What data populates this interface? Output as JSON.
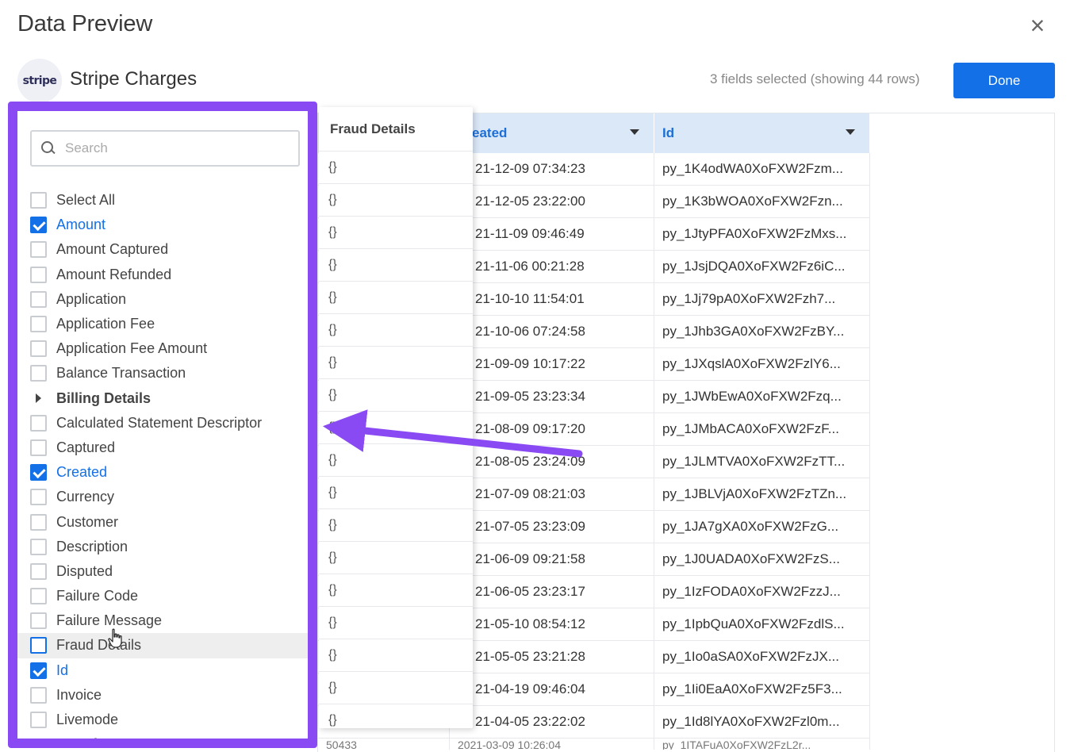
{
  "dialog": {
    "title": "Data Preview",
    "close_glyph": "×"
  },
  "source": {
    "logo_text": "stripe",
    "name": "Stripe Charges",
    "status": "3 fields selected (showing 44 rows)",
    "done_label": "Done"
  },
  "search": {
    "placeholder": "Search",
    "value": ""
  },
  "fields": [
    {
      "label": "Select All",
      "checked": false
    },
    {
      "label": "Amount",
      "checked": true
    },
    {
      "label": "Amount Captured",
      "checked": false
    },
    {
      "label": "Amount Refunded",
      "checked": false
    },
    {
      "label": "Application",
      "checked": false
    },
    {
      "label": "Application Fee",
      "checked": false
    },
    {
      "label": "Application Fee Amount",
      "checked": false
    },
    {
      "label": "Balance Transaction",
      "checked": false
    },
    {
      "label": "Billing Details",
      "group": true
    },
    {
      "label": "Calculated Statement Descriptor",
      "checked": false
    },
    {
      "label": "Captured",
      "checked": false
    },
    {
      "label": "Created",
      "checked": true
    },
    {
      "label": "Currency",
      "checked": false
    },
    {
      "label": "Customer",
      "checked": false
    },
    {
      "label": "Description",
      "checked": false
    },
    {
      "label": "Disputed",
      "checked": false
    },
    {
      "label": "Failure Code",
      "checked": false
    },
    {
      "label": "Failure Message",
      "checked": false
    },
    {
      "label": "Fraud Details",
      "checked": false,
      "hover": true
    },
    {
      "label": "Id",
      "checked": true
    },
    {
      "label": "Invoice",
      "checked": false
    },
    {
      "label": "Livemode",
      "checked": false
    },
    {
      "label": "Metadata",
      "group": true
    }
  ],
  "preview": {
    "header": "Fraud Details",
    "values": [
      "{}",
      "{}",
      "{}",
      "{}",
      "{}",
      "{}",
      "{}",
      "{}",
      "{}",
      "{}",
      "{}",
      "{}",
      "{}",
      "{}",
      "{}",
      "{}",
      "{}",
      "{}"
    ]
  },
  "table": {
    "amount_partial": "50433",
    "created_header": "eated",
    "created_values": [
      "21-12-09 07:34:23",
      "21-12-05 23:22:00",
      "21-11-09 09:46:49",
      "21-11-06 00:21:28",
      "21-10-10 11:54:01",
      "21-10-06 07:24:58",
      "21-09-09 10:17:22",
      "21-09-05 23:23:34",
      "21-08-09 09:17:20",
      "21-08-05 23:24:09",
      "21-07-09 08:21:03",
      "21-07-05 23:23:09",
      "21-06-09 09:21:58",
      "21-06-05 23:23:17",
      "21-05-10 08:54:12",
      "21-05-05 23:21:28",
      "21-04-19 09:46:04",
      "21-04-05 23:22:02"
    ],
    "created_partial": "2021-03-09 10:26:04",
    "id_header": "Id",
    "id_values": [
      "py_1K4odWA0XoFXW2Fzm...",
      "py_1K3bWOA0XoFXW2Fzn...",
      "py_1JtyPFA0XoFXW2FzMxs...",
      "py_1JsjDQA0XoFXW2Fz6iC...",
      "py_1Jj79pA0XoFXW2Fzh7...",
      "py_1Jhb3GA0XoFXW2FzBY...",
      "py_1JXqslA0XoFXW2FzlY6...",
      "py_1JWbEwA0XoFXW2Fzq...",
      "py_1JMbACA0XoFXW2FzF...",
      "py_1JLMTVA0XoFXW2FzTT...",
      "py_1JBLVjA0XoFXW2FzTZn...",
      "py_1JA7gXA0XoFXW2FzG...",
      "py_1J0UADA0XoFXW2FzS...",
      "py_1IzFODA0XoFXW2FzzJ...",
      "py_1IpbQuA0XoFXW2FzdlS...",
      "py_1Io0aSA0XoFXW2FzJX...",
      "py_1Ii0EaA0XoFXW2Fz5F3...",
      "py_1Id8lYA0XoFXW2Fzl0m..."
    ],
    "id_partial": "py_1ITAFuA0XoFXW2FzL2r..."
  },
  "colors": {
    "accent": "#1370e6",
    "highlight_border": "#8a4af3",
    "header_bg": "#dbe8f8"
  }
}
